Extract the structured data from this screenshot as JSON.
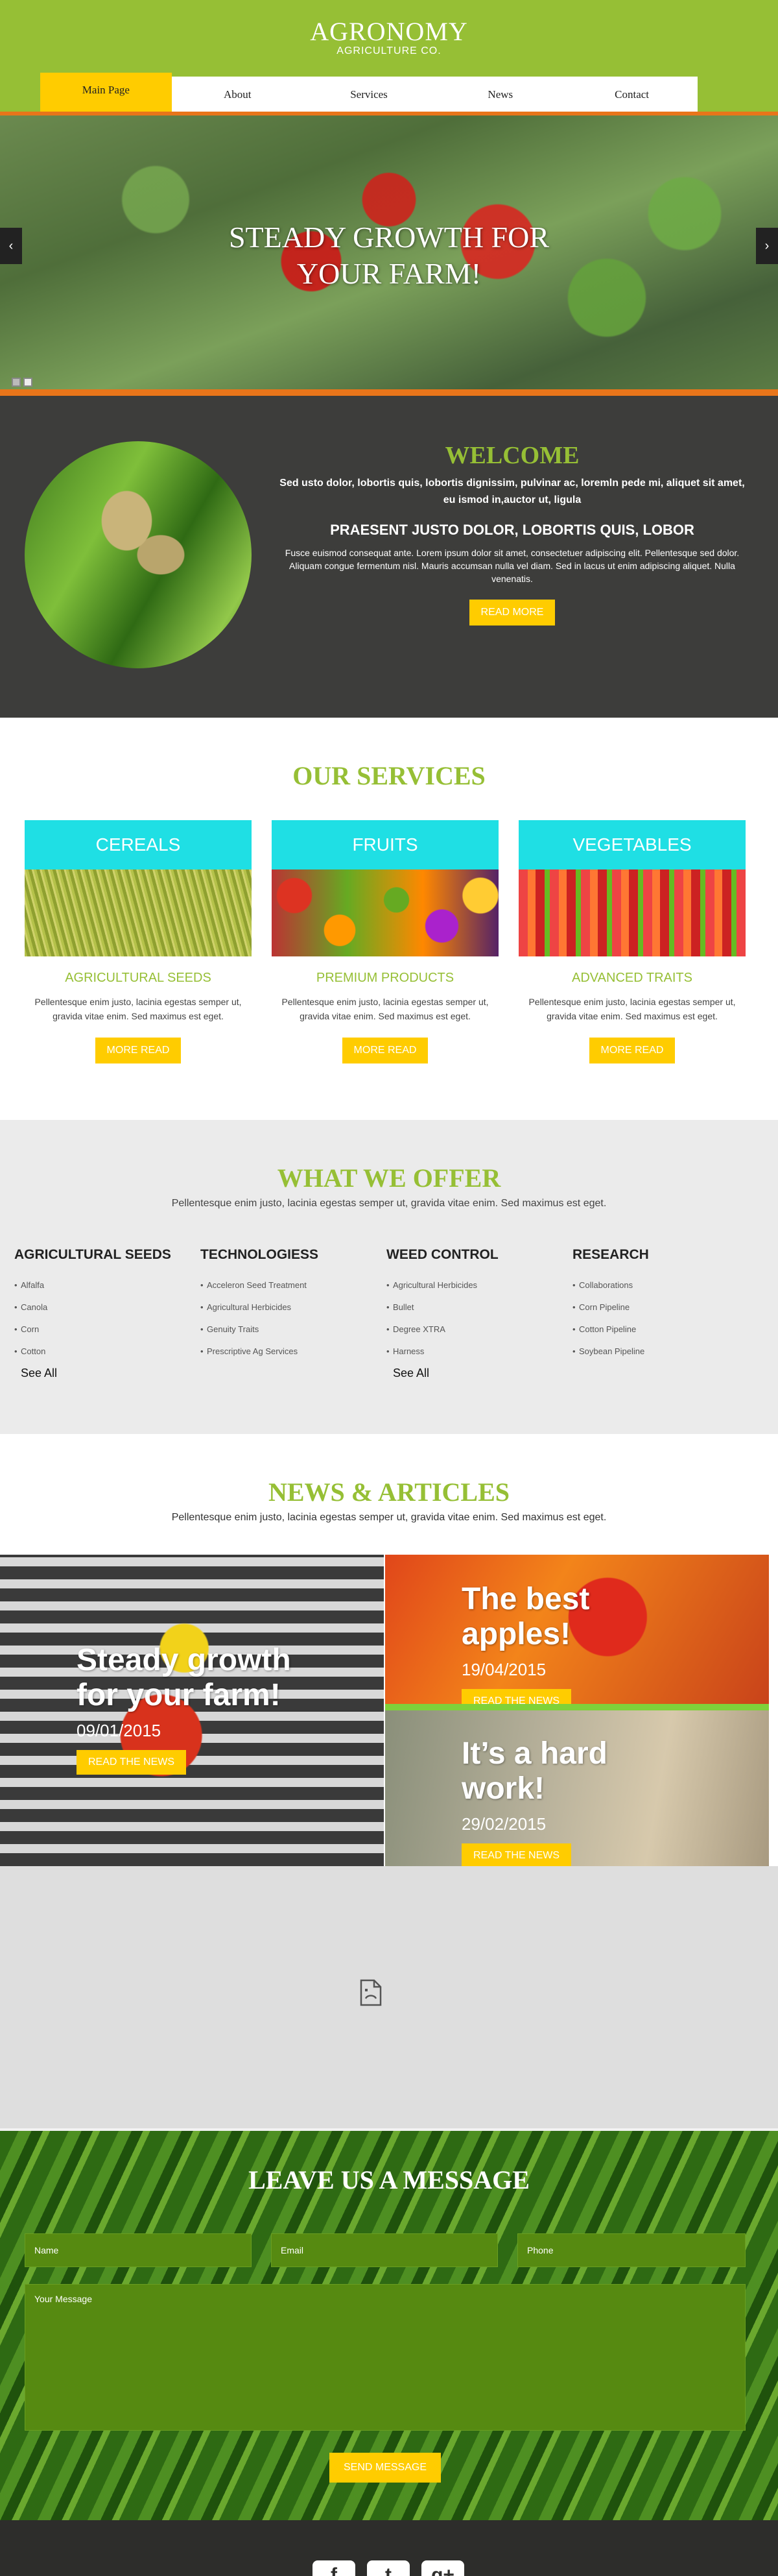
{
  "header": {
    "logo_title": "AGRONOMY",
    "logo_sub": "AGRICULTURE CO.",
    "nav": [
      "Main Page",
      "About",
      "Services",
      "News",
      "Contact"
    ]
  },
  "hero": {
    "title_line1": "STEADY GROWTH FOR",
    "title_line2": "YOUR FARM!",
    "prev_icon": "‹",
    "next_icon": "›"
  },
  "welcome": {
    "title": "WELCOME",
    "lead": "Sed usto dolor, lobortis quis, lobortis dignissim, pulvinar ac, loremln pede mi, aliquet sit amet, eu ismod in,auctor ut, ligula",
    "subtitle": "PRAESENT JUSTO DOLOR, LOBORTIS QUIS, LOBOR",
    "body": "Fusce euismod consequat ante. Lorem ipsum dolor sit amet, consectetuer adipiscing elit. Pellentesque sed dolor. Aliquam congue fermentum nisl. Mauris accumsan nulla vel diam. Sed in lacus ut enim adipiscing aliquet. Nulla venenatis.",
    "button": "READ MORE"
  },
  "services": {
    "title": "OUR SERVICES",
    "items": [
      {
        "head": "CEREALS",
        "name": "AGRICULTURAL SEEDS",
        "desc": "Pellentesque enim justo, lacinia egestas semper ut, gravida vitae enim. Sed maximus est eget.",
        "button": "MORE READ"
      },
      {
        "head": "FRUITS",
        "name": "PREMIUM PRODUCTS",
        "desc": "Pellentesque enim justo, lacinia egestas semper ut, gravida vitae enim. Sed maximus est eget.",
        "button": "MORE READ"
      },
      {
        "head": "VEGETABLES",
        "name": "ADVANCED TRAITS",
        "desc": "Pellentesque enim justo, lacinia egestas semper ut, gravida vitae enim. Sed maximus est eget.",
        "button": "MORE READ"
      }
    ]
  },
  "offer": {
    "title": "WHAT WE OFFER",
    "subtitle": "Pellentesque enim justo, lacinia egestas semper ut, gravida vitae enim. Sed maximus est eget.",
    "columns": [
      {
        "heading": "AGRICULTURAL SEEDS",
        "items": [
          "Alfalfa",
          "Canola",
          "Corn",
          "Cotton"
        ],
        "see_all": "See All"
      },
      {
        "heading": "TECHNOLOGIESS",
        "items": [
          "Acceleron Seed Treatment",
          "Agricultural Herbicides",
          "Genuity Traits",
          "Prescriptive Ag Services"
        ],
        "see_all": ""
      },
      {
        "heading": "WEED CONTROL",
        "items": [
          "Agricultural Herbicides",
          "Bullet",
          "Degree XTRA",
          "Harness"
        ],
        "see_all": "See All"
      },
      {
        "heading": "RESEARCH",
        "items": [
          "Collaborations",
          "Corn Pipeline",
          "Cotton Pipeline",
          "Soybean Pipeline"
        ],
        "see_all": ""
      }
    ]
  },
  "news": {
    "title": "NEWS & ARTICLES",
    "subtitle": "Pellentesque enim justo, lacinia egestas semper ut, gravida vitae enim. Sed maximus est eget.",
    "articles": [
      {
        "title_line1": "Steady growth",
        "title_line2": "for your farm!",
        "date": "09/01/2015",
        "button": "READ THE NEWS"
      },
      {
        "title_line1": "The best",
        "title_line2": "apples!",
        "date": "19/04/2015",
        "button": "READ THE NEWS"
      },
      {
        "title_line1": "It’s a hard",
        "title_line2": "work!",
        "date": "29/02/2015",
        "button": "READ THE NEWS"
      }
    ]
  },
  "contact": {
    "title": "LEAVE US A MESSAGE",
    "name_placeholder": "Name",
    "email_placeholder": "Email",
    "phone_placeholder": "Phone",
    "message_placeholder": "Your Message",
    "button": "SEND MESSAGE"
  },
  "footer": {
    "social": [
      "f",
      "t",
      "g+"
    ]
  },
  "colors": {
    "brand_green": "#96bf35",
    "accent_yellow": "#ffcc00",
    "accent_orange": "#e8751a",
    "cyan": "#1fdfe4",
    "dark": "#3d3d3b"
  }
}
